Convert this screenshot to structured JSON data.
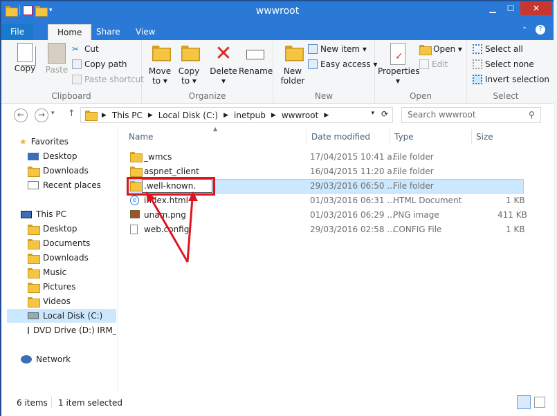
{
  "window": {
    "title": "wwwroot",
    "minimize": "▁",
    "maximize": "☐",
    "close": "✕"
  },
  "tabs": {
    "file": "File",
    "home": "Home",
    "share": "Share",
    "view": "View"
  },
  "ribbon": {
    "clipboard": {
      "label": "Clipboard",
      "copy": "Copy",
      "paste": "Paste",
      "cut": "Cut",
      "copy_path": "Copy path",
      "paste_shortcut": "Paste shortcut"
    },
    "organize": {
      "label": "Organize",
      "move_to": "Move",
      "move_to2": "to ▾",
      "copy_to": "Copy",
      "copy_to2": "to ▾",
      "delete": "Delete",
      "delete2": "▾",
      "rename": "Rename"
    },
    "new": {
      "label": "New",
      "new_folder": "New",
      "new_folder2": "folder",
      "new_item": "New item ▾",
      "easy_access": "Easy access ▾"
    },
    "open": {
      "label": "Open",
      "properties": "Properties",
      "properties2": "▾",
      "open": "Open ▾",
      "edit": "Edit"
    },
    "select": {
      "label": "Select",
      "select_all": "Select all",
      "select_none": "Select none",
      "invert": "Invert selection"
    }
  },
  "address": {
    "crumbs": [
      "This PC",
      "Local Disk (C:)",
      "inetpub",
      "wwwroot"
    ],
    "search_placeholder": "Search wwwroot"
  },
  "nav": {
    "favorites": "Favorites",
    "fav_items": [
      "Desktop",
      "Downloads",
      "Recent places"
    ],
    "this_pc": "This PC",
    "pc_items": [
      "Desktop",
      "Documents",
      "Downloads",
      "Music",
      "Pictures",
      "Videos",
      "Local Disk (C:)",
      "DVD Drive (D:) IRM_S"
    ],
    "network": "Network"
  },
  "columns": {
    "name": "Name",
    "date": "Date modified",
    "type": "Type",
    "size": "Size"
  },
  "files": [
    {
      "name": "_wmcs",
      "date": "17/04/2015 10:41 a...",
      "type": "File folder",
      "size": ""
    },
    {
      "name": "aspnet_client",
      "date": "16/04/2015 11:20 a...",
      "type": "File folder",
      "size": ""
    },
    {
      "name": ".well-known.",
      "date": "29/03/2016 06:50 ...",
      "type": "File folder",
      "size": ""
    },
    {
      "name": "index.html",
      "date": "01/03/2016 06:31 ...",
      "type": "HTML Document",
      "size": "1 KB"
    },
    {
      "name": "unam.png",
      "date": "01/03/2016 06:29 ...",
      "type": "PNG image",
      "size": "411 KB"
    },
    {
      "name": "web.config",
      "date": "29/03/2016 02:58 ...",
      "type": "CONFIG File",
      "size": "1 KB"
    }
  ],
  "status": {
    "items": "6 items",
    "selected": "1 item selected"
  },
  "colors": {
    "accent": "#2b79d6",
    "annotation": "#e0141e",
    "selection": "#cce8ff"
  }
}
